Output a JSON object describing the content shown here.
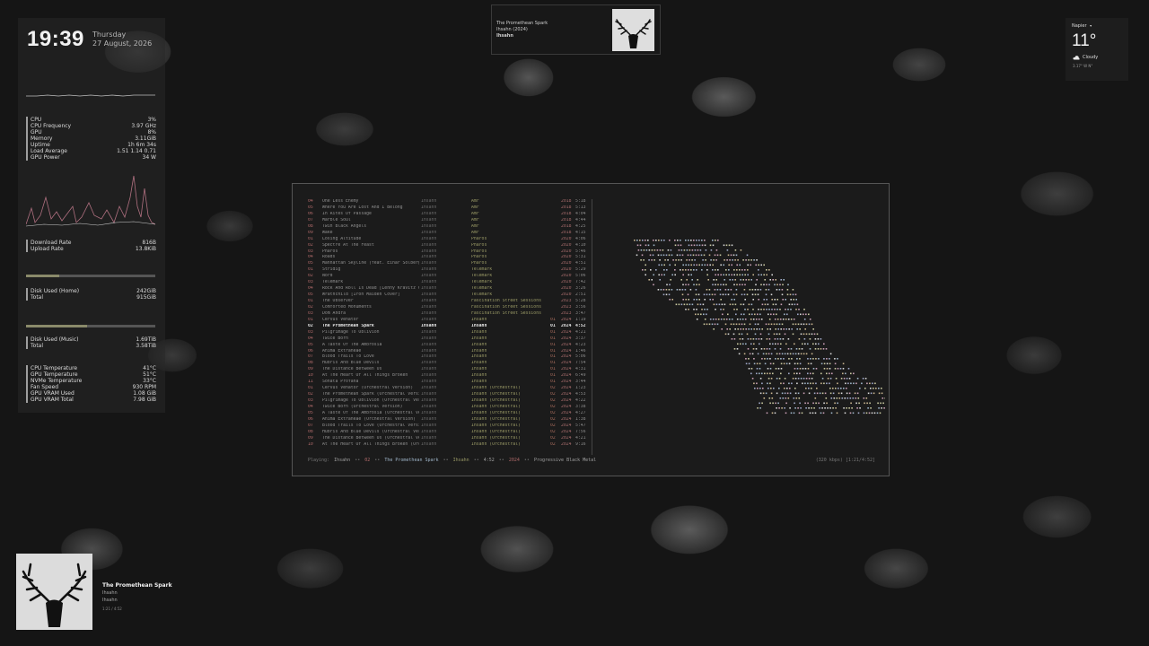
{
  "clock": {
    "time": "19:39",
    "weekday": "Thursday",
    "date": "27 August, 2026"
  },
  "stats": [
    {
      "label": "CPU",
      "value": "3%"
    },
    {
      "label": "CPU Frequency",
      "value": "3.97 GHz"
    },
    {
      "label": "GPU",
      "value": "8%"
    },
    {
      "label": "Memory",
      "value": "3.11GiB"
    },
    {
      "label": "Uptime",
      "value": "1h 6m 34s"
    },
    {
      "label": "Load Average",
      "value": "1.51 1.14 0.71"
    },
    {
      "label": "GPU Power",
      "value": "34 W"
    }
  ],
  "network": [
    {
      "label": "Download Rate",
      "value": "816B"
    },
    {
      "label": "Upload Rate",
      "value": "13.8KiB"
    }
  ],
  "disk_home": {
    "usage_fraction": 0.26,
    "rows": [
      {
        "label": "Disk Used (Home)",
        "value": "242GiB"
      },
      {
        "label": "Total",
        "value": "915GiB"
      }
    ]
  },
  "disk_music": {
    "usage_fraction": 0.47,
    "rows": [
      {
        "label": "Disk Used (Music)",
        "value": "1.69TiB"
      },
      {
        "label": "Total",
        "value": "3.58TiB"
      }
    ]
  },
  "sensors": [
    {
      "label": "CPU Temperature",
      "value": "41°C"
    },
    {
      "label": "GPU Temperature",
      "value": "51°C"
    },
    {
      "label": "NVMe Temperature",
      "value": "33°C"
    },
    {
      "label": "Fan Speed",
      "value": "930 RPM"
    },
    {
      "label": "GPU VRAM Used",
      "value": "1.08 GiB"
    },
    {
      "label": "GPU VRAM Total",
      "value": "7.98 GiB"
    }
  ],
  "now_playing_top": {
    "title": "The Promethean Spark",
    "album": "Ihsahn (2024)",
    "artist": "Ihsahn"
  },
  "weather": {
    "location": "Napier",
    "location_icon": "caret-down-icon",
    "temp": "11°",
    "condition": "Cloudy",
    "condition_icon": "cloud-icon",
    "extra": "3.17° W N°"
  },
  "tracks": [
    {
      "num": "04",
      "title": "One Less Enemy",
      "artist": "Ihsahn",
      "album": "Àmr",
      "disc": "",
      "year": "2018",
      "dur": "5:18"
    },
    {
      "num": "05",
      "title": "Where You Are Lost And I Belong",
      "artist": "Ihsahn",
      "album": "Àmr",
      "disc": "",
      "year": "2018",
      "dur": "5:13"
    },
    {
      "num": "06",
      "title": "In Rites Of Passage",
      "artist": "Ihsahn",
      "album": "Àmr",
      "disc": "",
      "year": "2018",
      "dur": "4:04"
    },
    {
      "num": "07",
      "title": "Marble Soul",
      "artist": "Ihsahn",
      "album": "Àmr",
      "disc": "",
      "year": "2018",
      "dur": "4:44"
    },
    {
      "num": "08",
      "title": "Twin Black Angels",
      "artist": "Ihsahn",
      "album": "Àmr",
      "disc": "",
      "year": "2018",
      "dur": "4:25"
    },
    {
      "num": "09",
      "title": "Wake",
      "artist": "Ihsahn",
      "album": "Àmr",
      "disc": "",
      "year": "2018",
      "dur": "4:15"
    },
    {
      "num": "01",
      "title": "Losing Altitude",
      "artist": "Ihsahn",
      "album": "Pharos",
      "disc": "",
      "year": "2020",
      "dur": "4:06"
    },
    {
      "num": "02",
      "title": "Spectre At The Feast",
      "artist": "Ihsahn",
      "album": "Pharos",
      "disc": "",
      "year": "2020",
      "dur": "4:10"
    },
    {
      "num": "03",
      "title": "Pharos",
      "artist": "Ihsahn",
      "album": "Pharos",
      "disc": "",
      "year": "2020",
      "dur": "5:46"
    },
    {
      "num": "04",
      "title": "Roads",
      "artist": "Ihsahn",
      "album": "Pharos",
      "disc": "",
      "year": "2020",
      "dur": "5:31"
    },
    {
      "num": "05",
      "title": "Manhattan Skyline (feat. Einar Solberg)",
      "artist": "Ihsahn",
      "album": "Pharos",
      "disc": "",
      "year": "2020",
      "dur": "4:51"
    },
    {
      "num": "01",
      "title": "Stridig",
      "artist": "Ihsahn",
      "album": "Telemark",
      "disc": "",
      "year": "2020",
      "dur": "5:29"
    },
    {
      "num": "02",
      "title": "Nord",
      "artist": "Ihsahn",
      "album": "Telemark",
      "disc": "",
      "year": "2020",
      "dur": "5:06"
    },
    {
      "num": "03",
      "title": "Telemark",
      "artist": "Ihsahn",
      "album": "Telemark",
      "disc": "",
      "year": "2020",
      "dur": "7:42"
    },
    {
      "num": "04",
      "title": "Rock And Roll Is Dead [Lenny Kravitz Cov",
      "artist": "Ihsahn",
      "album": "Telemark",
      "disc": "",
      "year": "2020",
      "dur": "3:26"
    },
    {
      "num": "05",
      "title": "Wrathchild [Iron Maiden Cover]",
      "artist": "Ihsahn",
      "album": "Telemark",
      "disc": "",
      "year": "2020",
      "dur": "2:51"
    },
    {
      "num": "01",
      "title": "The Observer",
      "artist": "Ihsahn",
      "album": "Fascination Street Sessions",
      "disc": "",
      "year": "2023",
      "dur": "5:28"
    },
    {
      "num": "02",
      "title": "Comforted Monuments",
      "artist": "Ihsahn",
      "album": "Fascination Street Sessions",
      "disc": "",
      "year": "2023",
      "dur": "3:56"
    },
    {
      "num": "03",
      "title": "Dom Andra",
      "artist": "Ihsahn",
      "album": "Fascination Street Sessions",
      "disc": "",
      "year": "2023",
      "dur": "3:47"
    },
    {
      "num": "01",
      "title": "Cervus Venator",
      "artist": "Ihsahn",
      "album": "Ihsahn",
      "disc": "01",
      "year": "2024",
      "dur": "1:19"
    },
    {
      "num": "02",
      "title": "The Promethean Spark",
      "artist": "Ihsahn",
      "album": "Ihsahn",
      "disc": "01",
      "year": "2024",
      "dur": "4:52",
      "current": true
    },
    {
      "num": "03",
      "title": "Pilgrimage To Oblivion",
      "artist": "Ihsahn",
      "album": "Ihsahn",
      "disc": "01",
      "year": "2024",
      "dur": "4:21"
    },
    {
      "num": "04",
      "title": "Twice Born",
      "artist": "Ihsahn",
      "album": "Ihsahn",
      "disc": "01",
      "year": "2024",
      "dur": "3:37"
    },
    {
      "num": "05",
      "title": "A Taste Of The Ambrosia",
      "artist": "Ihsahn",
      "album": "Ihsahn",
      "disc": "01",
      "year": "2024",
      "dur": "4:23"
    },
    {
      "num": "06",
      "title": "Anima Extraneae",
      "artist": "Ihsahn",
      "album": "Ihsahn",
      "disc": "01",
      "year": "2024",
      "dur": "1:46"
    },
    {
      "num": "07",
      "title": "Blood Trails To Love",
      "artist": "Ihsahn",
      "album": "Ihsahn",
      "disc": "01",
      "year": "2024",
      "dur": "5:06"
    },
    {
      "num": "08",
      "title": "Hubris And Blue Devils",
      "artist": "Ihsahn",
      "album": "Ihsahn",
      "disc": "01",
      "year": "2024",
      "dur": "7:54"
    },
    {
      "num": "09",
      "title": "The Distance Between Us",
      "artist": "Ihsahn",
      "album": "Ihsahn",
      "disc": "01",
      "year": "2024",
      "dur": "4:31"
    },
    {
      "num": "10",
      "title": "At The Heart Of All Things Broken",
      "artist": "Ihsahn",
      "album": "Ihsahn",
      "disc": "01",
      "year": "2024",
      "dur": "6:49"
    },
    {
      "num": "11",
      "title": "Sonata Profana",
      "artist": "Ihsahn",
      "album": "Ihsahn",
      "disc": "01",
      "year": "2024",
      "dur": "3:44"
    },
    {
      "num": "01",
      "title": "Cervus Venator (Orchestral Version)",
      "artist": "Ihsahn",
      "album": "Ihsahn (Orchestral)",
      "disc": "02",
      "year": "2024",
      "dur": "1:23"
    },
    {
      "num": "02",
      "title": "The Promethean Spark (Orchestral Version",
      "artist": "Ihsahn",
      "album": "Ihsahn (Orchestral)",
      "disc": "02",
      "year": "2024",
      "dur": "4:53"
    },
    {
      "num": "03",
      "title": "Pilgrimage To Oblivion (Orchestral Versi",
      "artist": "Ihsahn",
      "album": "Ihsahn (Orchestral)",
      "disc": "02",
      "year": "2024",
      "dur": "4:22"
    },
    {
      "num": "04",
      "title": "Twice Born (Orchestral Version)",
      "artist": "Ihsahn",
      "album": "Ihsahn (Orchestral)",
      "disc": "02",
      "year": "2024",
      "dur": "3:38"
    },
    {
      "num": "05",
      "title": "A Taste Of The Ambrosia (Orchestral Vers",
      "artist": "Ihsahn",
      "album": "Ihsahn (Orchestral)",
      "disc": "02",
      "year": "2024",
      "dur": "4:27"
    },
    {
      "num": "06",
      "title": "Anima Extraneae (Orchestral Version)",
      "artist": "Ihsahn",
      "album": "Ihsahn (Orchestral)",
      "disc": "02",
      "year": "2024",
      "dur": "1:38"
    },
    {
      "num": "07",
      "title": "Blood Trails To Love (Orchestral Version",
      "artist": "Ihsahn",
      "album": "Ihsahn (Orchestral)",
      "disc": "02",
      "year": "2024",
      "dur": "5:47"
    },
    {
      "num": "08",
      "title": "Hubris And Blue Devils (Orchestral Versi",
      "artist": "Ihsahn",
      "album": "Ihsahn (Orchestral)",
      "disc": "02",
      "year": "2024",
      "dur": "7:56"
    },
    {
      "num": "09",
      "title": "The Distance Between Us (Orchestral Vers",
      "artist": "Ihsahn",
      "album": "Ihsahn (Orchestral)",
      "disc": "02",
      "year": "2024",
      "dur": "4:21"
    },
    {
      "num": "10",
      "title": "At The Heart Of All Things Broken (Orche",
      "artist": "Ihsahn",
      "album": "Ihsahn (Orchestral)",
      "disc": "02",
      "year": "2024",
      "dur": "9:16"
    }
  ],
  "status": {
    "prefix": "Playing:",
    "artist": "Ihsahn",
    "sep": "••",
    "track_num": "02",
    "title": "The Promethean Spark",
    "album": "Ihsahn",
    "length": "4:52",
    "year": "2024",
    "genre": "Progressive Black Metal",
    "right": "(320 kbps) [1:21/4:52]"
  },
  "now_playing_bottom": {
    "title": "The Promethean Spark",
    "artist": "Ihsahn",
    "album": "Ihsahn",
    "progress": "1:21 / 4:52"
  },
  "colors": {
    "accent_red": "#b06a6a",
    "accent_olive": "#9a9a66",
    "viz_palette": [
      "#c9c9a0",
      "#9fb5c9",
      "#c99fb5",
      "#c9b58f",
      "#d8d8d8",
      "#a0a8c9"
    ]
  }
}
